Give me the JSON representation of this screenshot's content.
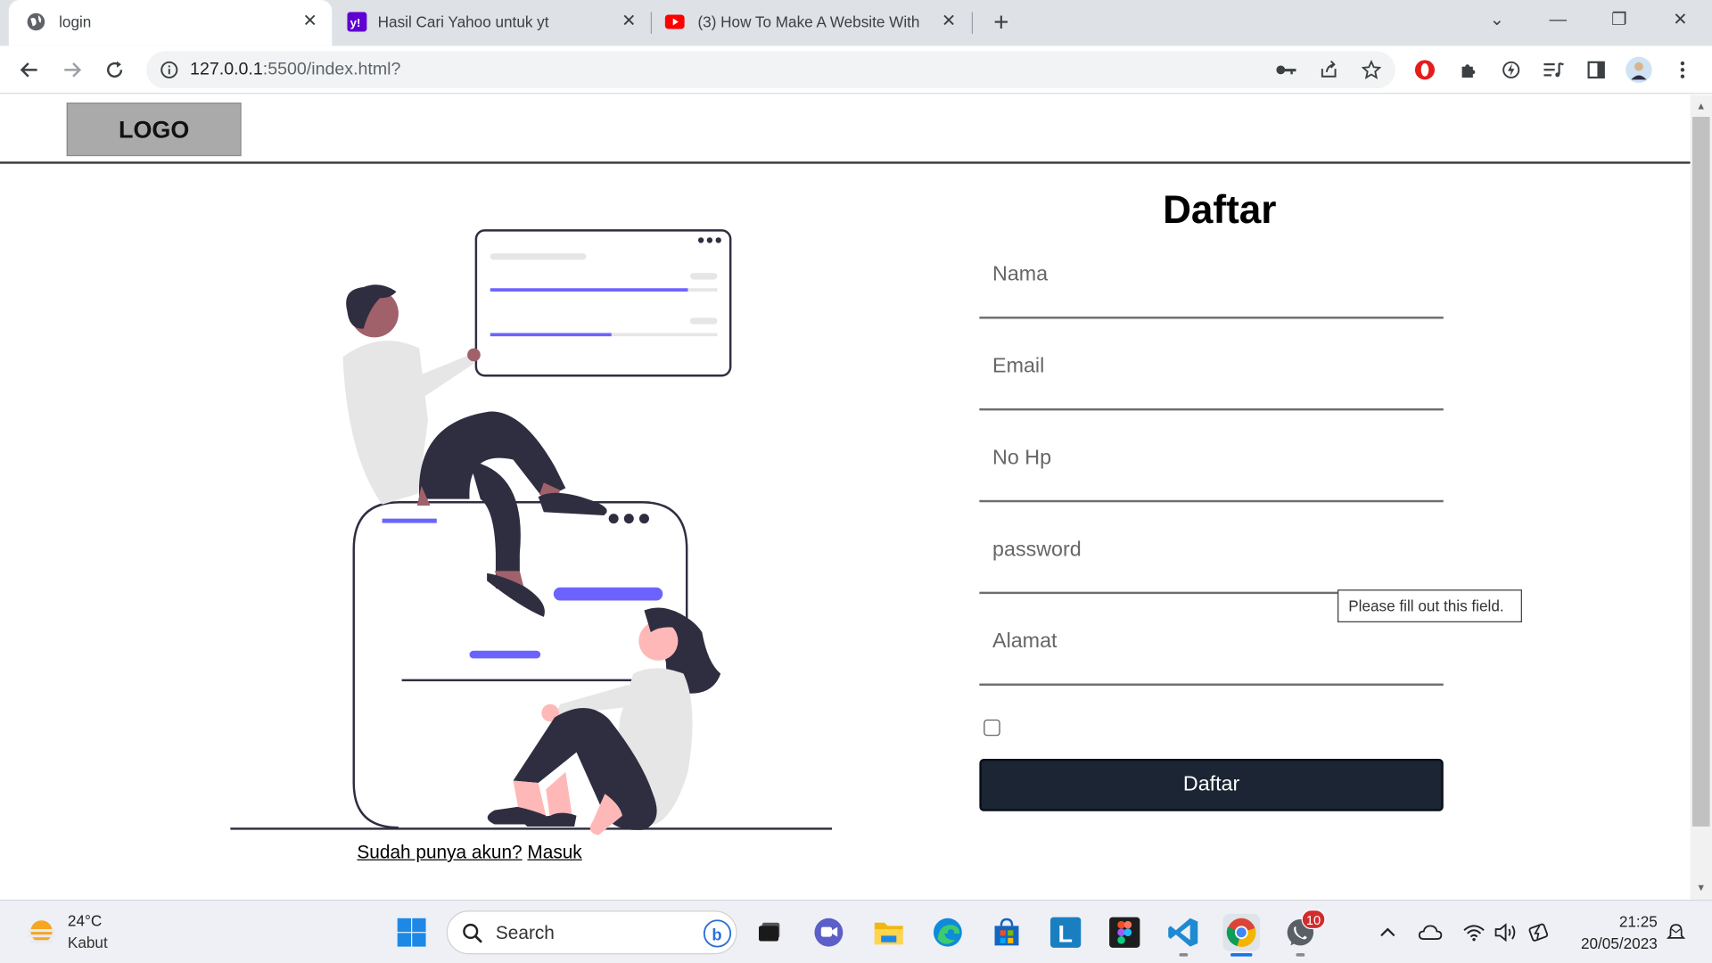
{
  "browser": {
    "tabs": [
      {
        "title": "login",
        "icon": "globe-icon"
      },
      {
        "title": "Hasil Cari Yahoo untuk yt",
        "icon": "yahoo-icon"
      },
      {
        "title": "(3) How To Make A Website With",
        "icon": "youtube-icon"
      }
    ],
    "url_host": "127.0.0.1",
    "url_path": ":5500/index.html?"
  },
  "page": {
    "logo": "LOGO",
    "form": {
      "title": "Daftar",
      "fields": [
        {
          "placeholder": "Nama"
        },
        {
          "placeholder": "Email"
        },
        {
          "placeholder": "No Hp"
        },
        {
          "placeholder": "password"
        },
        {
          "placeholder": "Alamat"
        }
      ],
      "validation_tooltip": "Please fill out this field.",
      "submit_label": "Daftar"
    },
    "already_text": "Sudah punya akun?",
    "login_link": "Masuk"
  },
  "taskbar": {
    "weather": {
      "temp": "24°C",
      "condition": "Kabut"
    },
    "search_label": "Search",
    "whatsapp_badge": "10",
    "time": "21:25",
    "date": "20/05/2023"
  },
  "colors": {
    "accent_purple": "#6c63ff",
    "figure_dark": "#2f2e41",
    "button_dark": "#1b2533"
  }
}
